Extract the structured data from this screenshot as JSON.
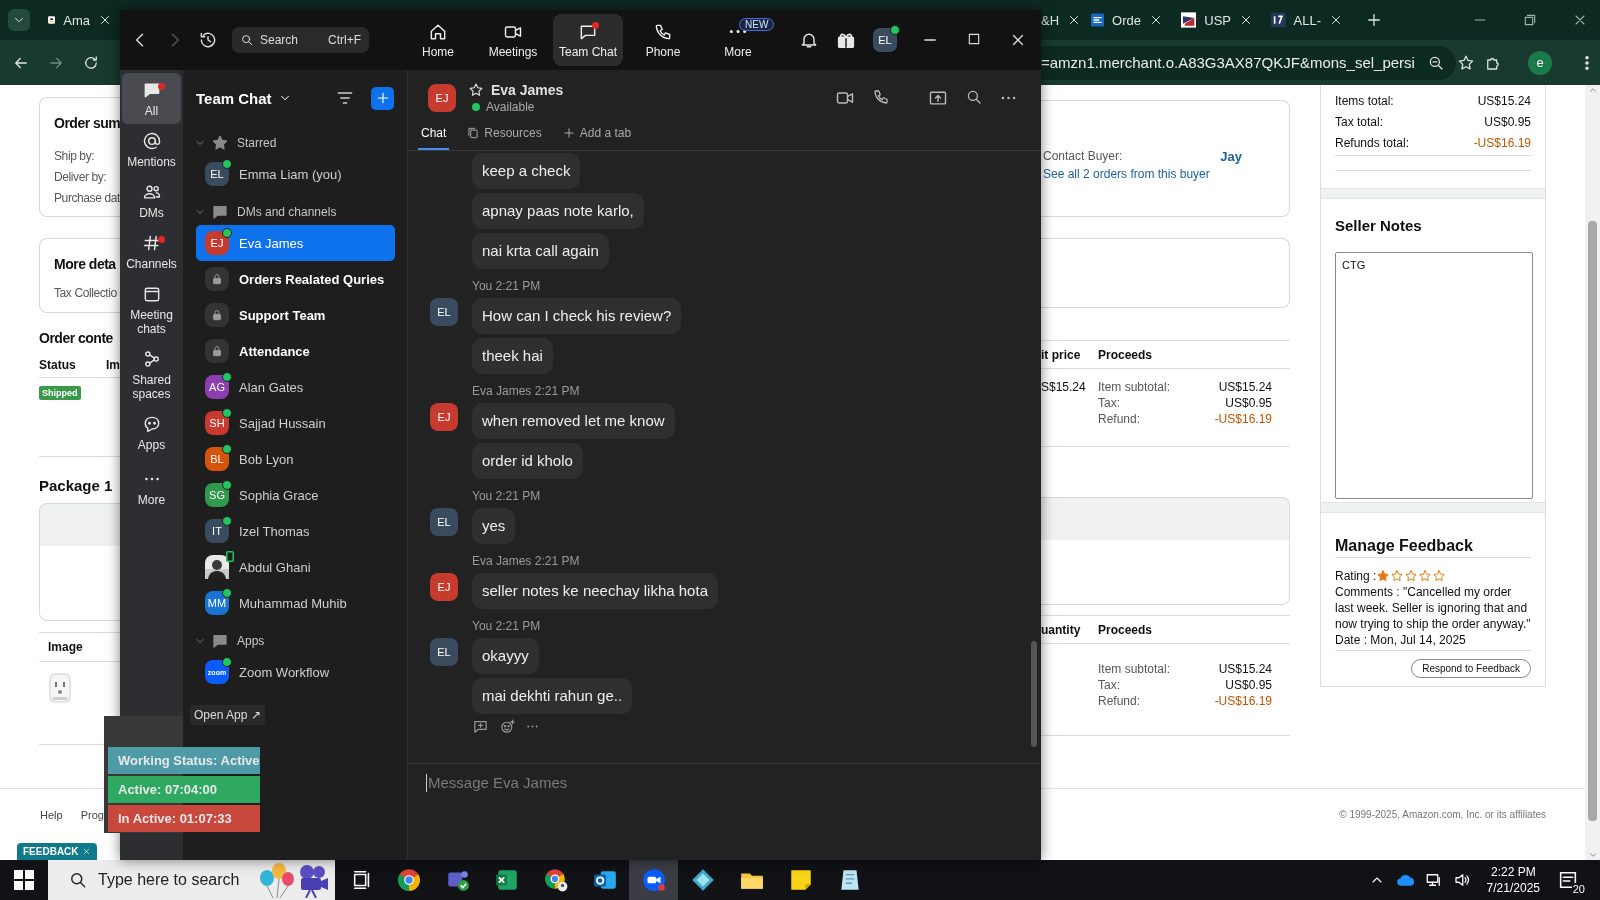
{
  "browser": {
    "tabs": [
      {
        "label": "Ama"
      },
      {
        "label": "&H"
      },
      {
        "label": "Orde"
      },
      {
        "label": "USP"
      },
      {
        "label": "ALL-"
      }
    ],
    "address": "=amzn1.merchant.o.A83G3AX87QKJF&mons_sel_persi",
    "profile": "e"
  },
  "order_page": {
    "left": {
      "summary_title": "Order sum",
      "summary_fields": [
        "Ship by:",
        "Deliver by:",
        "Purchase dat"
      ],
      "details_title": "More deta",
      "details_field": "Tax Collectio",
      "contents_title": "Order conte",
      "columns": [
        "Status",
        "Im"
      ],
      "status_badge": "Shipped",
      "package_title": "Package 1",
      "image_column": "Image"
    },
    "buyer": {
      "label": "Contact Buyer:",
      "name": "Jay",
      "orders_link": "See all 2 orders from this buyer"
    },
    "tables": [
      {
        "columns": [
          "it price",
          "Proceeds"
        ],
        "unit_price": "S$15.24",
        "rows": [
          {
            "label": "Item subtotal:",
            "value": "US$15.24",
            "negative": false
          },
          {
            "label": "Tax:",
            "value": "US$0.95",
            "negative": false
          },
          {
            "label": "Refund:",
            "value": "-US$16.19",
            "negative": true
          }
        ]
      },
      {
        "columns": [
          "uantity",
          "Proceeds"
        ],
        "rows": [
          {
            "label": "Item subtotal:",
            "value": "US$15.24",
            "negative": false
          },
          {
            "label": "Tax:",
            "value": "US$0.95",
            "negative": false
          },
          {
            "label": "Refund:",
            "value": "-US$16.19",
            "negative": true
          }
        ]
      }
    ],
    "totals": [
      {
        "label": "Items total:",
        "value": "US$15.24",
        "negative": false
      },
      {
        "label": "Tax total:",
        "value": "US$0.95",
        "negative": false
      },
      {
        "label": "Refunds total:",
        "value": "-US$16.19",
        "negative": true
      }
    ],
    "seller_notes": {
      "title": "Seller Notes",
      "value": "CTG"
    },
    "feedback": {
      "title": "Manage Feedback",
      "rating_label": "Rating :",
      "stars": 1,
      "comments": "Comments : \"Cancelled my order last week. Seller is ignoring that and now trying to ship the order anyway.\"",
      "date": "Date : Mon, Jul 14, 2025",
      "button": "Respond to Feedback"
    },
    "footer": {
      "links": [
        "Help",
        "Prog"
      ],
      "copyright": "© 1999-2025, Amazon.com, Inc. or its affiliates"
    },
    "feedback_tab": "FEEDBACK"
  },
  "zoom": {
    "forward": {
      "disabled": true
    },
    "search": {
      "placeholder": "Search",
      "shortcut": "Ctrl+F"
    },
    "nav": [
      {
        "label": "Home",
        "selected": false,
        "notify": false
      },
      {
        "label": "Meetings",
        "selected": false,
        "notify": false
      },
      {
        "label": "Team Chat",
        "selected": true,
        "notify": true
      },
      {
        "label": "Phone",
        "selected": false,
        "notify": false
      },
      {
        "label": "More",
        "selected": false,
        "notify": false,
        "badge": "NEW"
      }
    ],
    "profile": {
      "initials": "EL",
      "online": true
    },
    "rail": [
      {
        "label": "All",
        "selected": true,
        "notify": true
      },
      {
        "label": "Mentions",
        "selected": false,
        "notify": false
      },
      {
        "label": "DMs",
        "selected": false,
        "notify": false
      },
      {
        "label": "Channels",
        "selected": false,
        "notify": true
      },
      {
        "label": "Meeting chats",
        "selected": false,
        "notify": false
      },
      {
        "label": "Shared spaces",
        "selected": false,
        "notify": false
      },
      {
        "label": "Apps",
        "selected": false,
        "notify": false
      },
      {
        "label": "More",
        "selected": false,
        "notify": false
      }
    ],
    "list": {
      "title": "Team Chat",
      "sections": [
        {
          "label": "Starred",
          "expanded": true,
          "items": [
            {
              "kind": "person",
              "name": "Emma Liam (you)",
              "initials": "EL",
              "color": "#3b4b5e",
              "online": true,
              "selected": false,
              "unread": false
            }
          ]
        },
        {
          "label": "DMs and channels",
          "expanded": true,
          "items": [
            {
              "kind": "person",
              "name": "Eva James",
              "initials": "EJ",
              "color": "#c73a2e",
              "online": true,
              "selected": true,
              "unread": false
            },
            {
              "kind": "channel",
              "name": "Orders Realated Quries",
              "selected": false,
              "unread": true
            },
            {
              "kind": "channel",
              "name": "Support Team",
              "selected": false,
              "unread": true
            },
            {
              "kind": "channel",
              "name": "Attendance",
              "selected": false,
              "unread": true
            },
            {
              "kind": "person",
              "name": "Alan Gates",
              "initials": "AG",
              "color": "#8b3fae",
              "online": true,
              "selected": false,
              "unread": false
            },
            {
              "kind": "person",
              "name": "Sajjad Hussain",
              "initials": "SH",
              "color": "#c83a2e",
              "online": true,
              "selected": false,
              "unread": false
            },
            {
              "kind": "person",
              "name": "Bob Lyon",
              "initials": "BL",
              "color": "#d4540c",
              "online": true,
              "selected": false,
              "unread": false
            },
            {
              "kind": "person",
              "name": "Sophia Grace",
              "initials": "SG",
              "color": "#2f9a4b",
              "online": true,
              "selected": false,
              "unread": false
            },
            {
              "kind": "person",
              "name": "Izel Thomas",
              "initials": "IT",
              "color": "#3b4b5e",
              "online": true,
              "selected": false,
              "unread": false
            },
            {
              "name": "Abdul Ghani",
              "on_mobile": true,
              "selected": false,
              "unread": false
            },
            {
              "kind": "person",
              "name": "Muhammad Muhib",
              "initials": "MM",
              "color": "#1874d2",
              "online": true,
              "selected": false,
              "unread": false
            }
          ]
        },
        {
          "label": "Apps",
          "expanded": true,
          "items": [
            {
              "kind": "app",
              "name": "Zoom Workflow",
              "icon_text": "zoom",
              "online": true,
              "selected": false,
              "unread": false
            }
          ]
        }
      ],
      "open_app": "Open App ↗"
    },
    "chat": {
      "contact": {
        "name": "Eva James",
        "initials": "EJ",
        "color": "#c73a2e",
        "status": "Available",
        "online": true
      },
      "tabs": [
        {
          "label": "Chat",
          "selected": true
        },
        {
          "label": "Resources",
          "selected": false
        },
        {
          "label": "Add a tab",
          "selected": false
        }
      ],
      "groups": [
        {
          "texts": [
            "keep a check",
            "apnay paas note karlo,",
            "nai krta call again"
          ]
        },
        {
          "sender": "You",
          "time": "2:21 PM",
          "initials": "EL",
          "color": "#3b4b5e",
          "texts": [
            "How can I check his review?",
            "theek hai"
          ]
        },
        {
          "sender": "Eva James",
          "time": "2:21 PM",
          "initials": "EJ",
          "color": "#c73a2e",
          "texts": [
            "when removed let me know",
            "order id kholo"
          ]
        },
        {
          "sender": "You",
          "time": "2:21 PM",
          "initials": "EL",
          "color": "#3b4b5e",
          "texts": [
            "yes"
          ]
        },
        {
          "sender": "Eva James",
          "time": "2:21 PM",
          "initials": "EJ",
          "color": "#c73a2e",
          "texts": [
            "seller notes ke neechay likha hota"
          ]
        },
        {
          "sender": "You",
          "time": "2:21 PM",
          "initials": "EL",
          "color": "#3b4b5e",
          "texts": [
            "okayyy",
            "mai dekhti rahun ge.."
          ]
        }
      ],
      "composer": {
        "placeholder": "Message Eva James"
      }
    }
  },
  "work_status": [
    {
      "label": "Working Status: Active",
      "color": "#4e9aa6"
    },
    {
      "label": "Active: 07:04:00",
      "color": "#2fa862"
    },
    {
      "label": "In Active: 01:07:33",
      "color": "#c9483e"
    }
  ],
  "taskbar": {
    "search": {
      "placeholder": "Type here to search"
    },
    "apps": [
      {
        "selected": false
      },
      {
        "selected": false
      },
      {
        "selected": false
      },
      {
        "selected": false
      },
      {
        "selected": false
      },
      {
        "selected": true
      },
      {
        "selected": false
      },
      {
        "selected": false
      },
      {
        "selected": false
      },
      {
        "selected": false
      }
    ],
    "clock": {
      "time": "2:22 PM",
      "date": "7/21/2025"
    },
    "notifications": "20"
  }
}
